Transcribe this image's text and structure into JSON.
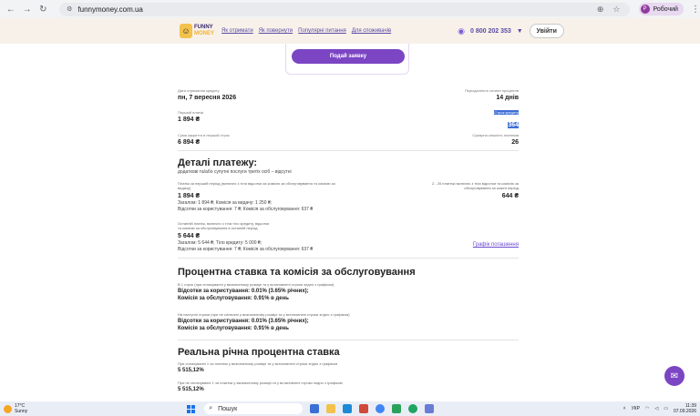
{
  "browser": {
    "url": "funnymoney.com.ua",
    "profile_initial": "Р",
    "profile_label": "Робочий"
  },
  "header": {
    "logo_line1": "FUNNY",
    "logo_line2": "MONEY",
    "nav": [
      "Як отримати",
      "Як повернути",
      "Популярні питання",
      "Для споживачів"
    ],
    "phone": "0 800 202 353",
    "login": "Увійти"
  },
  "card": {
    "submit": "Подай заявку"
  },
  "summary": {
    "date_label": "Дата отримання кредиту",
    "date_value": "пн, 7 вересня 2026",
    "period_label": "Періодичність сплати процентів",
    "period_value": "14 днів",
    "first_payment_label": "Перший платіж",
    "first_payment_value": "1 894 ₴",
    "term_label": "Строк кредиту",
    "term_value": "364",
    "total_first_label": "Сума закриття в перший строк",
    "total_first_value": "6 894 ₴",
    "count_label": "Сумарна кількість платежів",
    "count_value": "26"
  },
  "details": {
    "title": "Деталі платежу:",
    "subtitle": "додаткові та/або супутні послуги третіх осіб – відсутні",
    "first_note": "Платіж за перший період (включно з тіла відсотки за комісію за обслуговування та комісію за видачу)",
    "first_value": "1 894 ₴",
    "first_breakdown1": "Загалом: 1 894 ₴; Комісія за видачу: 1 250 ₴;",
    "first_breakdown2": "Відсотки за користування: 7 ₴; Комісія за обслуговування: 637 ₴",
    "middle_note": "2 - 26 платежі включно з тіла відсотки та комісію за обслуговування за кожен період",
    "middle_value": "644 ₴",
    "last_note1": "Останній платіж, включно з тіла тіло кредиту, відсотки",
    "last_note2": "та комісію за обслуговування в останній період",
    "last_value": "5 644 ₴",
    "last_breakdown1": "Загалом: 5 644 ₴; Тіло кредиту: 5 000 ₴;",
    "last_breakdown2": "Відсотки за користування: 7 ₴; Комісія за обслуговування: 637 ₴",
    "schedule_link": "Графік погашення"
  },
  "rates": {
    "title": "Процентна ставка та комісія за обслуговування",
    "first_note": "В 1 строк (при сплачуванні у визначеному розмірі та у встановлені строки згідно з графіком)",
    "first_interest": "Відсотки за користування: 0.01% (3.65% річних);",
    "first_fee": "Комісія за обслуговування: 0.91% в день",
    "next_note": "На наступні строки (при не сплачені у визначеному розмірі та у встановлені строки згідно з графіком)",
    "next_interest": "Відсотки за користування: 0.01% (3.65% річних);",
    "next_fee": "Комісія за обслуговування: 0.91% в день"
  },
  "apr": {
    "title": "Реальна річна процентна ставка",
    "note1": "При сплачуванні 1 чи платежі у визначеному розмірі та у встановлені строки згідно з графіком",
    "value1": "5 515,12%",
    "note2": "При не сплачуванні 1 чи платежі у визначеному розмірі та у встановлені строки згідно з графіком",
    "value2": "5 515,12%"
  },
  "taskbar": {
    "temp": "17°C",
    "weather": "Sunny",
    "search": "Пошук",
    "lang": "УКР",
    "time": "11:39",
    "date": "07.09.2026"
  }
}
